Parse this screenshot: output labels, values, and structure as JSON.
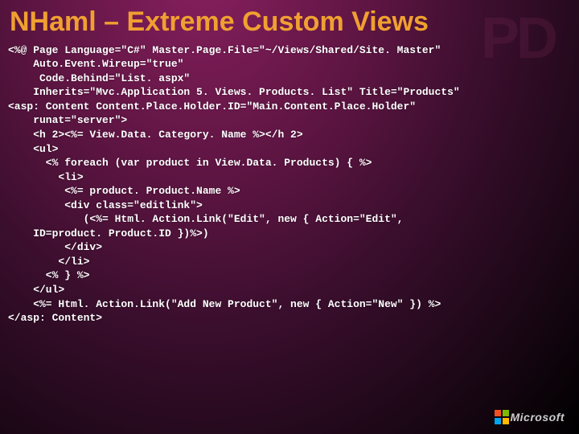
{
  "pd_watermark": "PD",
  "title": "NHaml – Extreme Custom Views",
  "code_lines": [
    "<%@ Page Language=\"C#\" Master.Page.File=\"~/Views/Shared/Site. Master\"",
    "    Auto.Event.Wireup=\"true\"",
    "     Code.Behind=\"List. aspx\"",
    "    Inherits=\"Mvc.Application 5. Views. Products. List\" Title=\"Products\"",
    "<asp: Content Content.Place.Holder.ID=\"Main.Content.Place.Holder\"",
    "    runat=\"server\">",
    "    <h 2><%= View.Data. Category. Name %></h 2>",
    "    <ul>",
    "      <% foreach (var product in View.Data. Products) { %>",
    "        <li>",
    "         <%= product. Product.Name %>",
    "         <div class=\"editlink\">",
    "            (<%= Html. Action.Link(\"Edit\", new { Action=\"Edit\",",
    "    ID=product. Product.ID })%>)",
    "         </div>",
    "        </li>",
    "      <% } %>",
    "    </ul>",
    "    <%= Html. Action.Link(\"Add New Product\", new { Action=\"New\" }) %>",
    "</asp: Content>"
  ],
  "logo_text": "Microsoft"
}
